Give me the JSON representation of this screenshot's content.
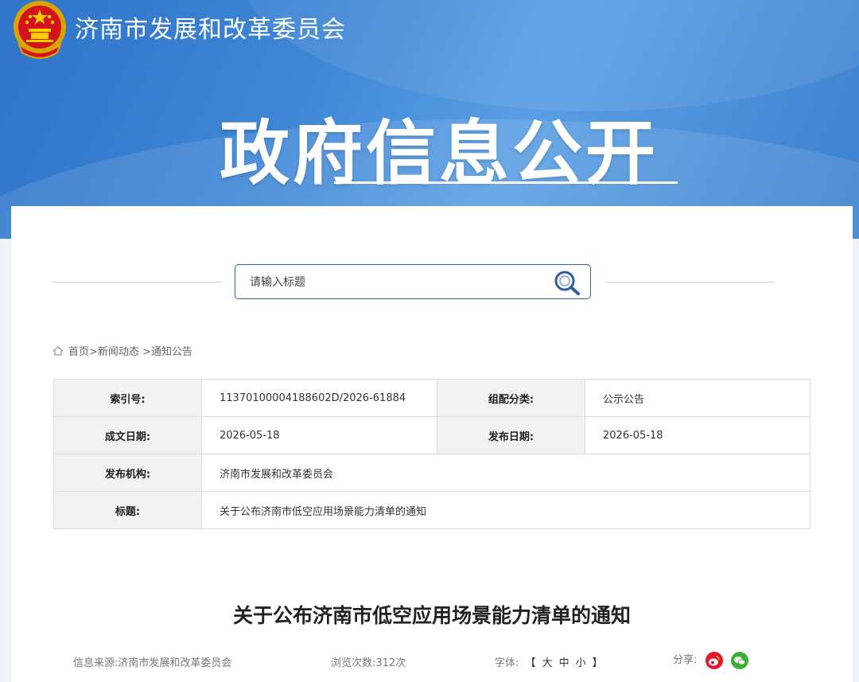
{
  "header": {
    "org_title": "济南市发展和改革委员会",
    "hero_title": "政府信息公开"
  },
  "search": {
    "placeholder": "请输入标题"
  },
  "breadcrumb": {
    "items": [
      "首页",
      ">新闻动态",
      ">通知公告"
    ]
  },
  "info": {
    "index_label": "索引号:",
    "index_value": "11370100004188602D/2026-61884",
    "category_label": "组配分类:",
    "category_value": "公示公告",
    "written_label": "成文日期:",
    "written_value": "2026-05-18",
    "published_label": "发布日期:",
    "published_value": "2026-05-18",
    "agency_label": "发布机构:",
    "agency_value": "济南市发展和改革委员会",
    "title_label": "标题:",
    "title_value": "关于公布济南市低空应用场景能力清单的通知"
  },
  "article": {
    "title": "关于公布济南市低空应用场景能力清单的通知",
    "source_label": "信息来源:",
    "source_value": "济南市发展和改革委员会",
    "views_label": "浏览次数:",
    "views_value": "312次",
    "font_label": "字体:",
    "font_open": "【",
    "font_large": "大",
    "font_medium": "中",
    "font_small": "小",
    "font_close": "】",
    "share_label": "分享:"
  },
  "colors": {
    "banner": "#3f86d6",
    "search_border": "#2b5ea3",
    "weibo": "#e6162d",
    "wechat": "#3cb034"
  }
}
